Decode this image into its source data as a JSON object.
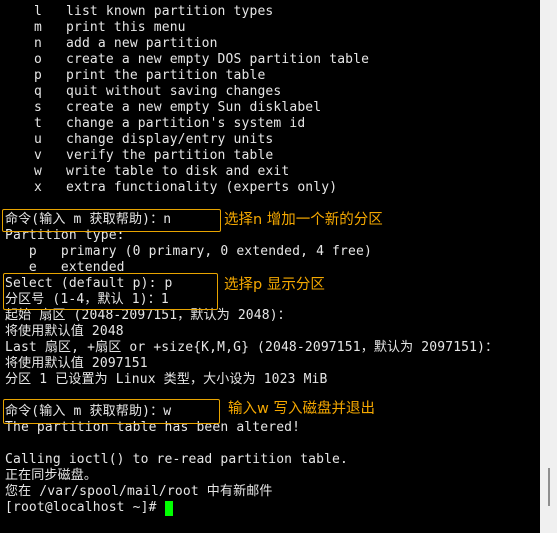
{
  "terminal": {
    "menu": [
      {
        "key": "l",
        "desc": "list known partition types"
      },
      {
        "key": "m",
        "desc": "print this menu"
      },
      {
        "key": "n",
        "desc": "add a new partition"
      },
      {
        "key": "o",
        "desc": "create a new empty DOS partition table"
      },
      {
        "key": "p",
        "desc": "print the partition table"
      },
      {
        "key": "q",
        "desc": "quit without saving changes"
      },
      {
        "key": "s",
        "desc": "create a new empty Sun disklabel"
      },
      {
        "key": "t",
        "desc": "change a partition's system id"
      },
      {
        "key": "u",
        "desc": "change display/entry units"
      },
      {
        "key": "v",
        "desc": "verify the partition table"
      },
      {
        "key": "w",
        "desc": "write table to disk and exit"
      },
      {
        "key": "x",
        "desc": "extra functionality (experts only)"
      }
    ],
    "lines": [
      "命令(输入 m 获取帮助)：n",
      "Partition type:",
      "   p   primary (0 primary, 0 extended, 4 free)",
      "   e   extended",
      "Select (default p): p",
      "分区号 (1-4，默认 1)：1",
      "起始 扇区 (2048-2097151，默认为 2048)：",
      "将使用默认值 2048",
      "Last 扇区, +扇区 or +size{K,M,G} (2048-2097151，默认为 2097151)：",
      "将使用默认值 2097151",
      "分区 1 已设置为 Linux 类型，大小设为 1023 MiB",
      "",
      "命令(输入 m 获取帮助)：w",
      "The partition table has been altered!",
      "",
      "Calling ioctl() to re-read partition table.",
      "正在同步磁盘。",
      "您在 /var/spool/mail/root 中有新邮件",
      "[root@localhost ~]# "
    ]
  },
  "annotations": [
    {
      "label": "选择n 增加一个新的分区"
    },
    {
      "label": "选择p 显示分区"
    },
    {
      "label": "输入w 写入磁盘并退出"
    }
  ],
  "colors": {
    "background": "#000000",
    "text": "#e6e6e6",
    "annotation": "#f5a800",
    "cursor": "#00ff00",
    "scrollbar_track": "#f0f0f0",
    "scrollbar_thumb": "#8f8f8f"
  }
}
